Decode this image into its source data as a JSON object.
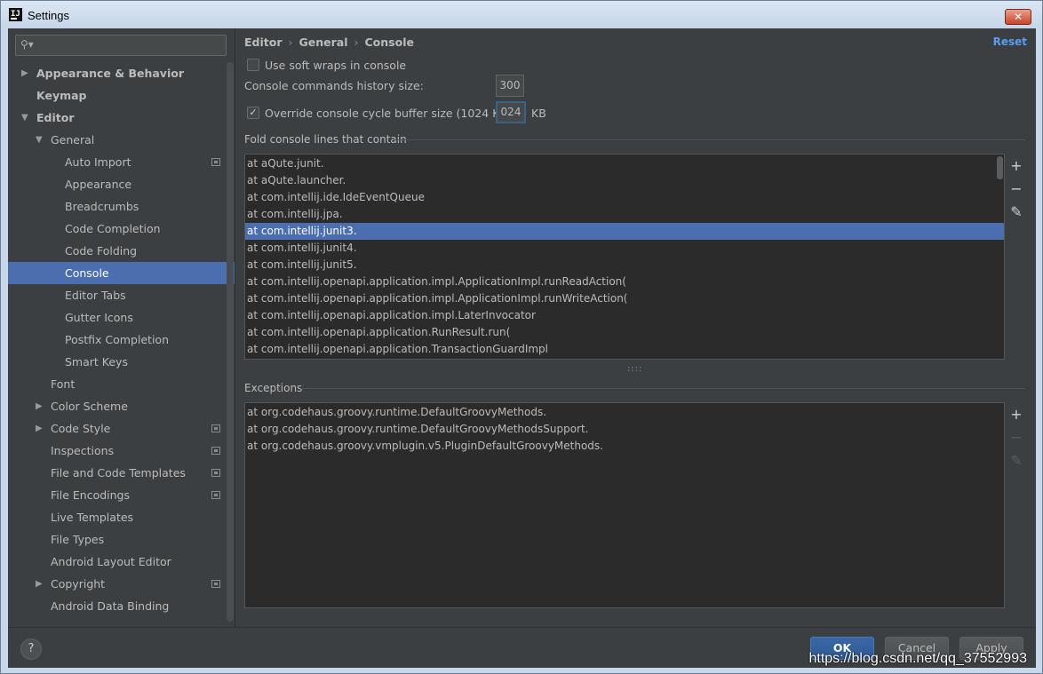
{
  "window": {
    "title": "Settings",
    "close_label": "✕"
  },
  "sidebar": {
    "search_placeholder": "",
    "items": [
      {
        "label": "Appearance & Behavior"
      },
      {
        "label": "Keymap"
      },
      {
        "label": "Editor"
      },
      {
        "label": "General"
      },
      {
        "label": "Auto Import"
      },
      {
        "label": "Appearance"
      },
      {
        "label": "Breadcrumbs"
      },
      {
        "label": "Code Completion"
      },
      {
        "label": "Code Folding"
      },
      {
        "label": "Console"
      },
      {
        "label": "Editor Tabs"
      },
      {
        "label": "Gutter Icons"
      },
      {
        "label": "Postfix Completion"
      },
      {
        "label": "Smart Keys"
      },
      {
        "label": "Font"
      },
      {
        "label": "Color Scheme"
      },
      {
        "label": "Code Style"
      },
      {
        "label": "Inspections"
      },
      {
        "label": "File and Code Templates"
      },
      {
        "label": "File Encodings"
      },
      {
        "label": "Live Templates"
      },
      {
        "label": "File Types"
      },
      {
        "label": "Android Layout Editor"
      },
      {
        "label": "Copyright"
      },
      {
        "label": "Android Data Binding"
      }
    ]
  },
  "breadcrumb": [
    "Editor",
    "General",
    "Console"
  ],
  "breadcrumb_separator": "›",
  "reset_label": "Reset",
  "options": {
    "soft_wraps_label": "Use soft wraps in console",
    "soft_wraps_checked": false,
    "history_label": "Console commands history size:",
    "history_value": "300",
    "override_label": "Override console cycle buffer size (1024 KB)",
    "override_checked": true,
    "override_check_glyph": "✓",
    "buffer_value": "024",
    "buffer_unit": "KB"
  },
  "fold_section": {
    "title": "Fold console lines that contain",
    "selected_index": 4,
    "items": [
      "at aQute.junit.",
      "at aQute.launcher.",
      "at com.intellij.ide.IdeEventQueue",
      "at com.intellij.jpa.",
      "at com.intellij.junit3.",
      "at com.intellij.junit4.",
      "at com.intellij.junit5.",
      "at com.intellij.openapi.application.impl.ApplicationImpl.runReadAction(",
      "at com.intellij.openapi.application.impl.ApplicationImpl.runWriteAction(",
      "at com.intellij.openapi.application.impl.LaterInvocator",
      "at com.intellij.openapi.application.RunResult.run(",
      "at com.intellij.openapi.application.TransactionGuardImpl"
    ]
  },
  "exceptions_section": {
    "title": "Exceptions",
    "items": [
      "at org.codehaus.groovy.runtime.DefaultGroovyMethods.",
      "at org.codehaus.groovy.runtime.DefaultGroovyMethodsSupport.",
      "at org.codehaus.groovy.vmplugin.v5.PluginDefaultGroovyMethods."
    ]
  },
  "toolbar": {
    "add": "+",
    "remove": "−",
    "edit": "✎"
  },
  "buttons": {
    "help": "?",
    "ok": "OK",
    "cancel": "Cancel",
    "apply": "Apply"
  },
  "watermark": "https://blog.csdn.net/qq_37552993",
  "colors": {
    "selection": "#4b6eaf",
    "link": "#589df6",
    "background": "#3c3f41"
  }
}
